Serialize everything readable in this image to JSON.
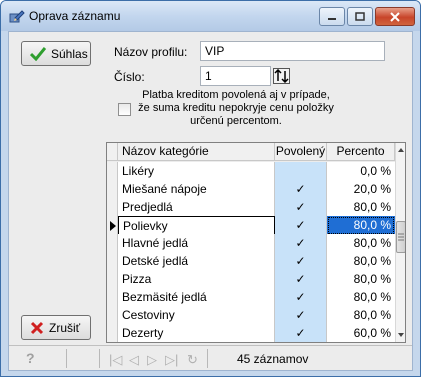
{
  "window": {
    "title": "Oprava záznamu"
  },
  "buttons": {
    "ok": "Súhlas",
    "cancel": "Zrušiť"
  },
  "form": {
    "profile_label": "Názov profilu:",
    "profile_value": "VIP",
    "number_label": "Číslo:",
    "number_value": "1",
    "credit_checkbox_label": "Platba kreditom povolená aj v prípade, že suma kreditu nepokryje cenu položky určenú percentom.",
    "credit_checkbox_checked": false
  },
  "grid": {
    "columns": [
      "Názov kategórie",
      "Povolený",
      "Percento"
    ],
    "rows": [
      {
        "name": "Likéry",
        "allowed": "",
        "percent": "0,0 %"
      },
      {
        "name": "Miešané nápoje",
        "allowed": "✓",
        "percent": "20,0 %"
      },
      {
        "name": "Predjedlá",
        "allowed": "✓",
        "percent": "80,0 %"
      },
      {
        "name": "Polievky",
        "allowed": "✓",
        "percent": "80,0 %"
      },
      {
        "name": "Hlavné jedlá",
        "allowed": "✓",
        "percent": "80,0 %"
      },
      {
        "name": "Detské jedlá",
        "allowed": "✓",
        "percent": "80,0 %"
      },
      {
        "name": "Pizza",
        "allowed": "✓",
        "percent": "80,0 %"
      },
      {
        "name": "Bezmäsité jedlá",
        "allowed": "✓",
        "percent": "80,0 %"
      },
      {
        "name": "Cestoviny",
        "allowed": "✓",
        "percent": "80,0 %"
      },
      {
        "name": "Dezerty",
        "allowed": "✓",
        "percent": "60,0 %"
      }
    ],
    "current_row_index": 3
  },
  "status": {
    "record_count": "45 záznamov"
  },
  "icons": {
    "title": "edit-record-icon",
    "ok": "checkmark-icon",
    "cancel": "red-x-icon",
    "help": "help-icon",
    "spinner": "up-down-spinner-icon"
  },
  "colors": {
    "ok_check": "#2e9e2e",
    "cancel_x": "#d02020",
    "selected_cell": "#1f6ed4",
    "allowed_column": "#c8e2f9"
  }
}
